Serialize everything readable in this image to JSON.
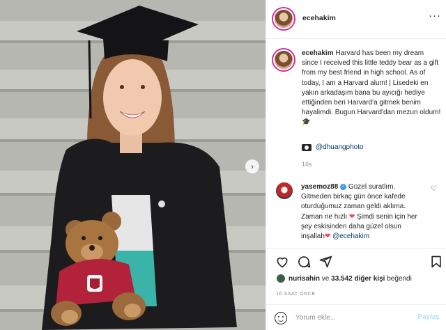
{
  "post": {
    "username": "ecehakim",
    "more_label": "···",
    "caption": "Harvard has been my dream since I received this little teddy bear as a gift from my best friend in high school. As of today, I am a Harvard alum! | Lisedeki en yakın arkadaşım bana bu ayıcığı hediye ettiğinden beri Harvard'a gitmek benim hayalimdi. Bugun Harvard'dan mezun oldum! 🎓",
    "photo_credit": "@dhuangphoto",
    "caption_time": "16s",
    "next_label": "›"
  },
  "comment": {
    "username": "yasemoz88",
    "text_before": " Güzel suratlım. Gitmeden birkaç gün önce kafede oturduğumuz zaman geldi aklıma. Zaman ne hızlı ",
    "heart1": "❤",
    "text_mid": " Şimdi senin için her şey eskisinden daha güzel olsun inşallah",
    "heart2": "❤",
    "mention": " @ecehakim",
    "verified": "✓",
    "like_icon": "♡"
  },
  "likes": {
    "liker": "nurisahin",
    "and": " ve ",
    "count_text": "33.542 diğer kişi",
    "suffix": " beğendi"
  },
  "post_time": "16 SAAT ÖNCE",
  "comment_box": {
    "placeholder": "Yorum ekle...",
    "post_label": "Paylaş"
  },
  "icons": {
    "heart": "heart-icon",
    "comment": "comment-icon",
    "share": "share-icon",
    "save": "bookmark-icon",
    "emoji": "emoji-icon",
    "more": "more-options-icon",
    "camera": "camera-icon"
  },
  "colors": {
    "link": "#00376b",
    "verified": "#3897f0",
    "heart": "#ed4956",
    "post_button": "#b2dffc",
    "meta": "#8e8e8e"
  }
}
